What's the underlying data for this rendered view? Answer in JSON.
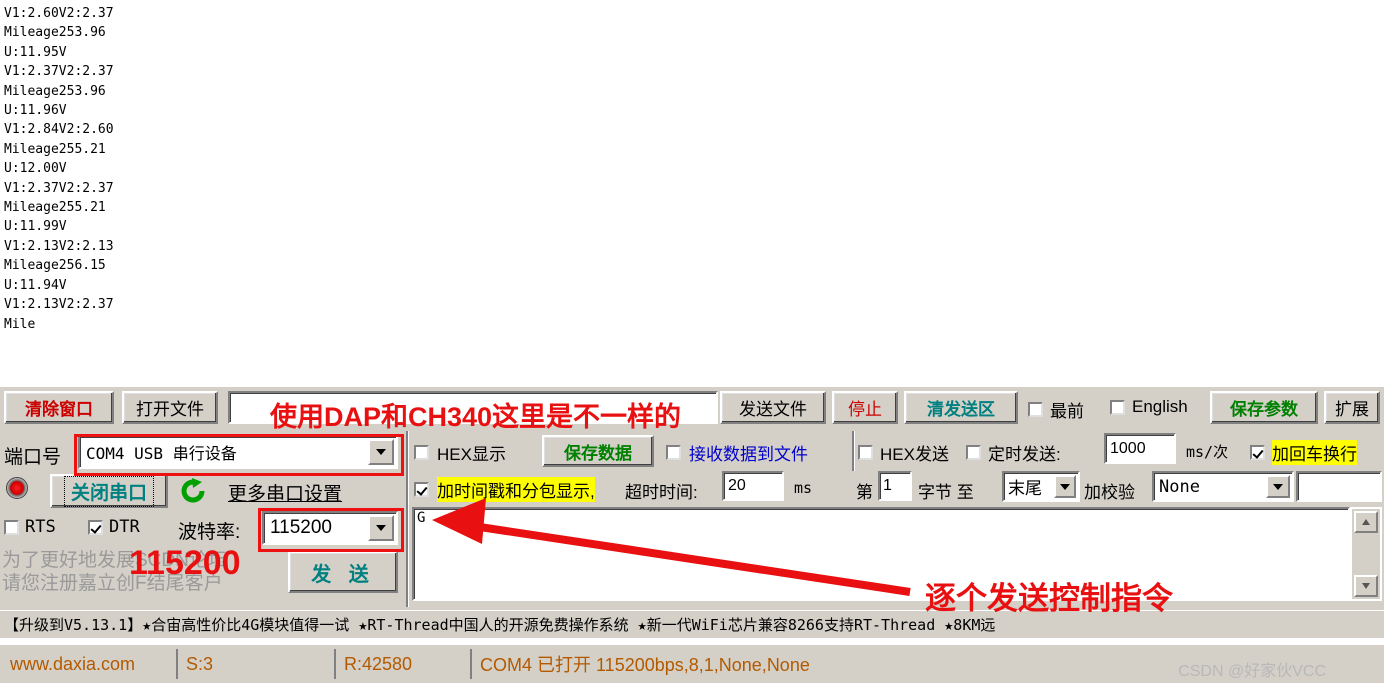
{
  "receive": {
    "text": "V1:2.60V2:2.37\nMileage253.96\nU:11.95V\nV1:2.37V2:2.37\nMileage253.96\nU:11.96V\nV1:2.84V2:2.60\nMileage255.21\nU:12.00V\nV1:2.37V2:2.37\nMileage255.21\nU:11.99V\nV1:2.13V2:2.13\nMileage256.15\nU:11.94V\nV1:2.13V2:2.37\nMile"
  },
  "toolbar": {
    "clear_window": "清除窗口",
    "open_file": "打开文件",
    "file_path_value": "",
    "send_file": "发送文件",
    "stop": "停止",
    "clear_send_area": "清发送区",
    "topmost": "最前",
    "english": "English",
    "save_params": "保存参数",
    "extend": "扩展"
  },
  "port": {
    "port_label": "端口号",
    "port_value": "COM4 USB 串行设备",
    "close_port": "关闭串口",
    "more_settings": "更多串口设置",
    "rts": "RTS",
    "dtr": "DTR",
    "baud_label": "波特率:",
    "baud_value": "115200",
    "promo_line1": "为了更好地发展SCDN论坛",
    "promo_line2": "请您注册嘉立创F结尾客户",
    "send_button": "发 送"
  },
  "recv_opts": {
    "hex_display": "HEX显示",
    "save_data": "保存数据",
    "recv_to_file": "接收数据到文件",
    "timestamp_pack": "加时间戳和分包显示,",
    "timeout_label": "超时时间:",
    "timeout_value": "20",
    "timeout_unit": "ms"
  },
  "send_opts": {
    "hex_send": "HEX发送",
    "timed_send": "定时发送:",
    "interval_value": "1000",
    "interval_unit": "ms/次",
    "add_crlf": "加回车换行",
    "byte_prefix": "第",
    "byte_index": "1",
    "byte_mid": "字节 至",
    "byte_end": "末尾",
    "checksum_label": "加校验",
    "checksum_value": "None"
  },
  "send_area": {
    "content": "G"
  },
  "marquee": {
    "text": "【升级到V5.13.1】★合宙高性价比4G模块值得一试 ★RT-Thread中国人的开源免费操作系统 ★新一代WiFi芯片兼容8266支持RT-Thread ★8KM远"
  },
  "status": {
    "site": "www.daxia.com",
    "sent": "S:3",
    "received": "R:42580",
    "connection": "COM4 已打开  115200bps,8,1,None,None",
    "watermark": "CSDN @好家伙VCC"
  },
  "annotations": {
    "toolbar_note": "使用DAP和CH340这里是不一样的",
    "baud_note": "115200",
    "send_note": "逐个发送控制指令"
  },
  "colors": {
    "accent_red": "#e81010",
    "teal": "#008080",
    "green": "#008000",
    "blue": "#0000cc",
    "highlight_yellow": "#ffff00",
    "status_orange": "#b35a00",
    "chrome": "#d4d0c8"
  }
}
